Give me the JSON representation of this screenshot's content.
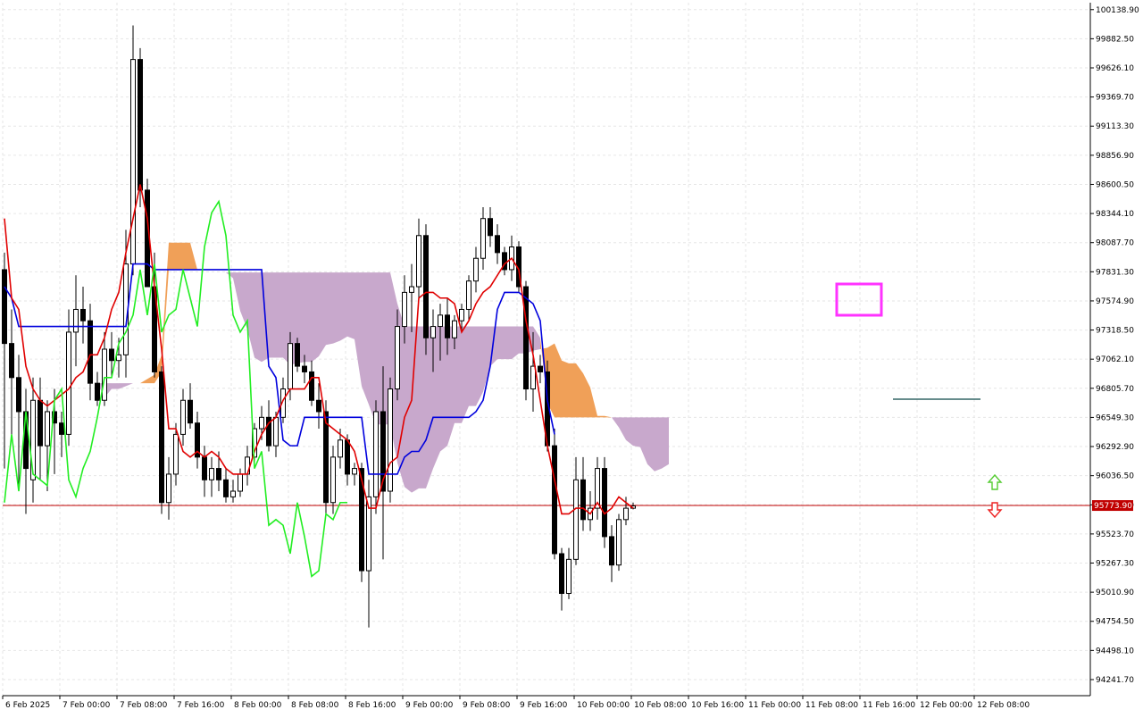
{
  "chart_data": {
    "type": "candlestick",
    "y_axis_labels": [
      "100138.90",
      "99882.50",
      "99626.10",
      "99369.70",
      "99113.30",
      "98856.90",
      "98600.50",
      "98344.10",
      "98087.70",
      "97831.30",
      "97574.90",
      "97318.50",
      "97062.10",
      "96805.70",
      "96549.30",
      "96292.90",
      "96036.50",
      "95780.10",
      "95523.70",
      "95267.30",
      "95010.90",
      "94754.50",
      "94498.10",
      "94241.70"
    ],
    "x_axis_labels": [
      "6 Feb 2025",
      "7 Feb 00:00",
      "7 Feb 08:00",
      "7 Feb 16:00",
      "8 Feb 00:00",
      "8 Feb 08:00",
      "8 Feb 16:00",
      "9 Feb 00:00",
      "9 Feb 08:00",
      "9 Feb 16:00",
      "10 Feb 00:00",
      "10 Feb 08:00",
      "10 Feb 16:00",
      "11 Feb 00:00",
      "11 Feb 08:00",
      "11 Feb 16:00",
      "12 Feb 00:00",
      "12 Feb 08:00"
    ],
    "ylim": [
      94100,
      100200
    ],
    "current_price": 95773.9,
    "current_price_label": "95773.90",
    "colors": {
      "background": "#ffffff",
      "grid": "#e6e6e6",
      "candle_bull_fill": "#ffffff",
      "candle_bear_fill": "#000000",
      "candle_outline": "#000000",
      "tenkan_sen": "#e00000",
      "kijun_sen": "#0000dd",
      "chikou_span": "#22ee22",
      "cloud_bearish": "#c8a8cc",
      "cloud_bullish": "#f0a058",
      "cloud_projection_line": "#336666",
      "current_price_line": "#c00000",
      "highlight_box": "#ff33ff",
      "up_arrow": "#55cc33",
      "down_arrow": "#ee2222"
    },
    "candles": [
      [
        97850,
        98000,
        96100,
        97200
      ],
      [
        97200,
        97500,
        96400,
        96900
      ],
      [
        96900,
        97100,
        95900,
        96600
      ],
      [
        96600,
        96800,
        95700,
        96100
      ],
      [
        96000,
        96900,
        95800,
        96700
      ],
      [
        96700,
        96900,
        96000,
        96300
      ],
      [
        96300,
        96700,
        95900,
        96600
      ],
      [
        96600,
        96800,
        96050,
        96500
      ],
      [
        96500,
        96600,
        96200,
        96400
      ],
      [
        96400,
        97500,
        96300,
        97300
      ],
      [
        97300,
        97800,
        97000,
        97500
      ],
      [
        97500,
        97700,
        97200,
        97400
      ],
      [
        97400,
        97550,
        96700,
        96850
      ],
      [
        96850,
        96950,
        96650,
        96700
      ],
      [
        96700,
        97300,
        96650,
        97150
      ],
      [
        97150,
        97300,
        96900,
        97050
      ],
      [
        97050,
        97250,
        96900,
        97100
      ],
      [
        97100,
        98200,
        96900,
        97900
      ],
      [
        97900,
        100000,
        97800,
        99700
      ],
      [
        99700,
        99800,
        98400,
        98550
      ],
      [
        98550,
        98650,
        97700,
        97700
      ],
      [
        97700,
        98000,
        96900,
        96950
      ],
      [
        96950,
        97000,
        95700,
        95800
      ],
      [
        95800,
        96200,
        95650,
        96050
      ],
      [
        96050,
        96500,
        95950,
        96400
      ],
      [
        96400,
        96800,
        96300,
        96700
      ],
      [
        96700,
        96850,
        96450,
        96500
      ],
      [
        96500,
        96600,
        96100,
        96200
      ],
      [
        96200,
        96300,
        95850,
        96000
      ],
      [
        96000,
        96200,
        95850,
        96100
      ],
      [
        96100,
        96250,
        95900,
        96000
      ],
      [
        96000,
        96100,
        95800,
        95850
      ],
      [
        95850,
        96000,
        95800,
        95900
      ],
      [
        95900,
        96100,
        95850,
        96050
      ],
      [
        96050,
        96300,
        95950,
        96200
      ],
      [
        96200,
        96500,
        96100,
        96450
      ],
      [
        96450,
        96650,
        96350,
        96550
      ],
      [
        96550,
        96700,
        96250,
        96300
      ],
      [
        96300,
        96600,
        96200,
        96550
      ],
      [
        96550,
        96900,
        96500,
        96800
      ],
      [
        96800,
        97300,
        96700,
        97200
      ],
      [
        97200,
        97250,
        96950,
        97000
      ],
      [
        97000,
        97100,
        96850,
        96950
      ],
      [
        96950,
        97050,
        96650,
        96700
      ],
      [
        96700,
        96850,
        96450,
        96600
      ],
      [
        96600,
        96700,
        95700,
        95800
      ],
      [
        95800,
        96300,
        95700,
        96200
      ],
      [
        96200,
        96450,
        96100,
        96350
      ],
      [
        96350,
        96400,
        95950,
        96050
      ],
      [
        96050,
        96150,
        95950,
        96100
      ],
      [
        96100,
        96150,
        95100,
        95200
      ],
      [
        95200,
        96000,
        94700,
        95850
      ],
      [
        95850,
        96700,
        95700,
        96600
      ],
      [
        96600,
        97000,
        95300,
        95900
      ],
      [
        95900,
        96900,
        95800,
        96800
      ],
      [
        96800,
        97500,
        96700,
        97350
      ],
      [
        97350,
        97800,
        97200,
        97650
      ],
      [
        97650,
        97900,
        97300,
        97700
      ],
      [
        97700,
        98300,
        97600,
        98150
      ],
      [
        98150,
        98250,
        97100,
        97250
      ],
      [
        97250,
        97500,
        96950,
        97350
      ],
      [
        97350,
        97550,
        97050,
        97450
      ],
      [
        97450,
        97600,
        97100,
        97250
      ],
      [
        97250,
        97450,
        97150,
        97400
      ],
      [
        97400,
        97550,
        97300,
        97500
      ],
      [
        97500,
        97800,
        97400,
        97750
      ],
      [
        97750,
        98050,
        97650,
        97950
      ],
      [
        97950,
        98400,
        97850,
        98300
      ],
      [
        98300,
        98400,
        98050,
        98150
      ],
      [
        98150,
        98250,
        97900,
        98000
      ],
      [
        98000,
        98050,
        97800,
        97850
      ],
      [
        97850,
        98150,
        97750,
        98050
      ],
      [
        98050,
        98100,
        97650,
        97700
      ],
      [
        97700,
        97750,
        96700,
        96800
      ],
      [
        96800,
        97300,
        96600,
        97000
      ],
      [
        97000,
        97100,
        96850,
        96950
      ],
      [
        96950,
        97050,
        96250,
        96300
      ],
      [
        96300,
        96450,
        95300,
        95350
      ],
      [
        95350,
        95400,
        94850,
        95000
      ],
      [
        95000,
        95400,
        94950,
        95300
      ],
      [
        95300,
        96200,
        95250,
        96000
      ],
      [
        96000,
        96200,
        95550,
        95650
      ],
      [
        95650,
        95900,
        95550,
        95750
      ],
      [
        95750,
        96200,
        95650,
        96100
      ],
      [
        96100,
        96200,
        95400,
        95500
      ],
      [
        95500,
        95600,
        95100,
        95250
      ],
      [
        95250,
        95700,
        95200,
        95650
      ],
      [
        95650,
        95850,
        95600,
        95750
      ],
      [
        95750,
        95800,
        95740,
        95770
      ]
    ],
    "tenkan_sen": [
      98300,
      97600,
      97500,
      97000,
      96800,
      96700,
      96650,
      96700,
      96750,
      96800,
      96900,
      96950,
      97100,
      97100,
      97250,
      97500,
      97650,
      98000,
      98300,
      98600,
      98300,
      97700,
      97150,
      96450,
      96450,
      96250,
      96200,
      96250,
      96200,
      96250,
      96200,
      96100,
      96050,
      96050,
      96050,
      96250,
      96400,
      96500,
      96550,
      96700,
      96800,
      96800,
      96800,
      96900,
      96900,
      96500,
      96450,
      96400,
      96350,
      96250,
      96000,
      95750,
      95750,
      96000,
      96150,
      96200,
      96550,
      96700,
      97600,
      97650,
      97650,
      97600,
      97600,
      97550,
      97300,
      97400,
      97550,
      97650,
      97700,
      97800,
      97900,
      97950,
      97850,
      97400,
      97100,
      96700,
      96300,
      96000,
      95700,
      95700,
      95750,
      95750,
      95700,
      95800,
      95700,
      95750,
      95850,
      95800,
      95750
    ],
    "kijun_sen": [
      97700,
      97600,
      97350,
      97350,
      97350,
      97350,
      97350,
      97350,
      97350,
      97350,
      97350,
      97350,
      97350,
      97350,
      97350,
      97350,
      97350,
      97350,
      97900,
      97900,
      97900,
      97850,
      97850,
      97850,
      97850,
      97850,
      97850,
      97850,
      97850,
      97850,
      97850,
      97850,
      97850,
      97850,
      97850,
      97850,
      97850,
      97000,
      96900,
      96350,
      96300,
      96300,
      96550,
      96550,
      96550,
      96550,
      96550,
      96550,
      96550,
      96550,
      96550,
      96050,
      96050,
      96050,
      96050,
      96050,
      96200,
      96250,
      96250,
      96350,
      96550,
      96550,
      96550,
      96550,
      96550,
      96550,
      96600,
      96700,
      97000,
      97500,
      97650,
      97650,
      97650,
      97600,
      97550,
      97400,
      96700,
      96400
    ],
    "chikou_span": [
      95800,
      96400,
      95900,
      96600,
      96050,
      96000,
      95950,
      96700,
      96800,
      96000,
      95850,
      96100,
      96250,
      96550,
      96900,
      96900,
      97200,
      97300,
      97450,
      97850,
      97450,
      97900,
      97300,
      97450,
      97500,
      97850,
      97600,
      97350,
      98050,
      98350,
      98450,
      98150,
      97450,
      97300,
      97400,
      96100,
      96250,
      95600,
      95650,
      95600,
      95350,
      95800,
      95500,
      95150,
      95200,
      95700,
      95650,
      95800,
      95800
    ]
  },
  "ui": {
    "arrow_up_icon": "arrow-up-icon",
    "arrow_down_icon": "arrow-down-icon"
  }
}
